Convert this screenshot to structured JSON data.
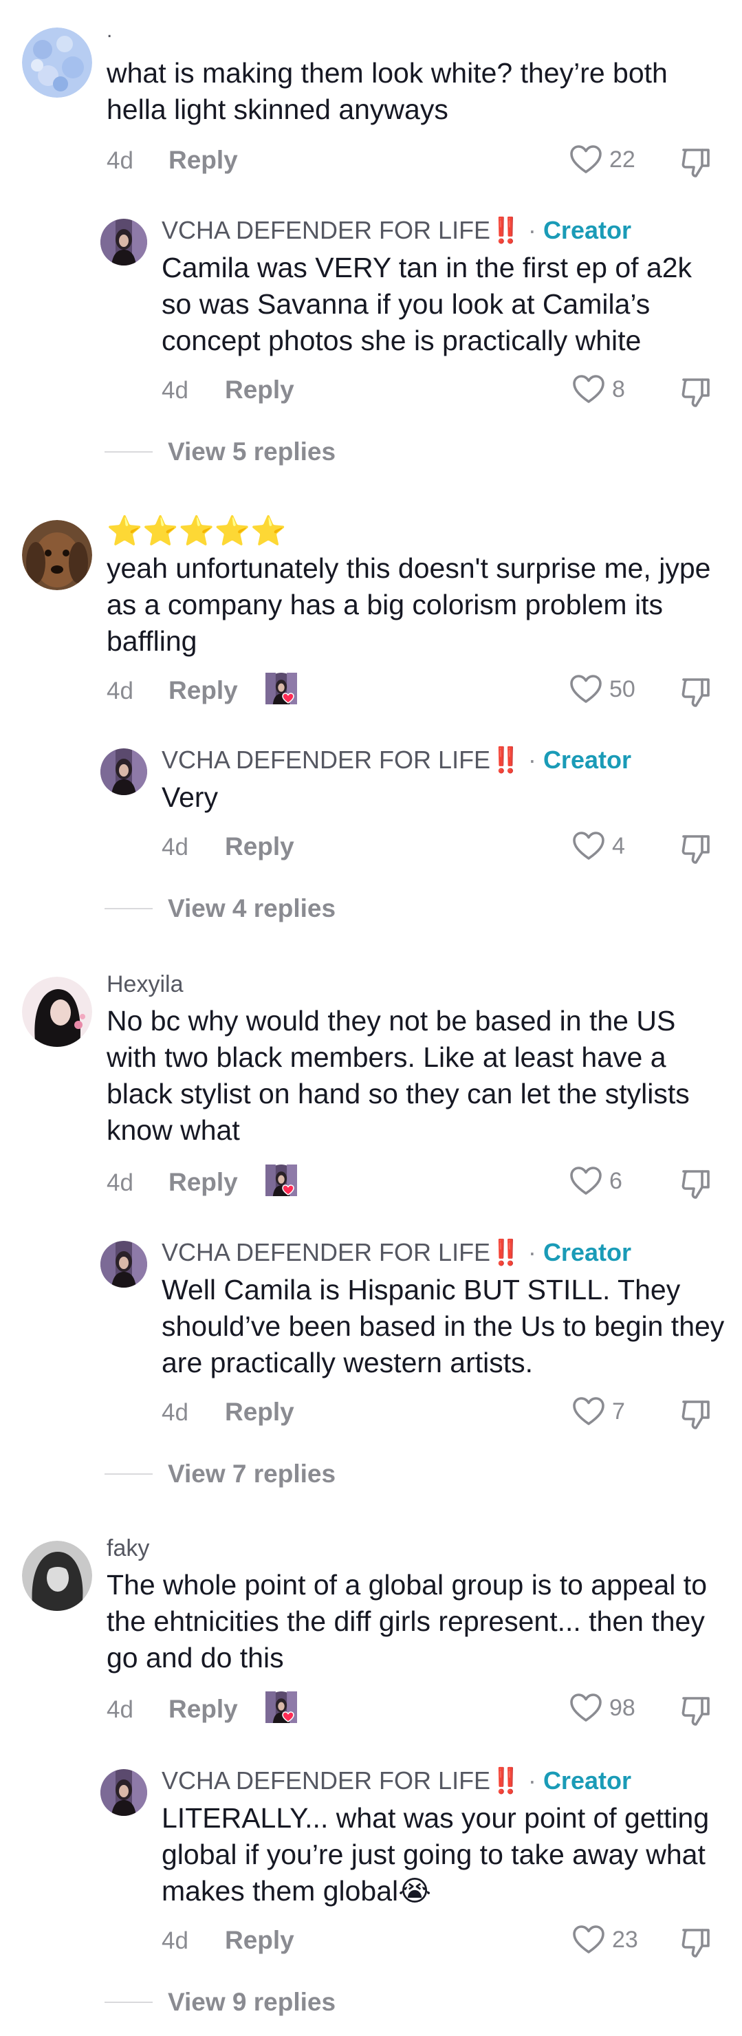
{
  "comments": [
    {
      "username": ".",
      "text": "what is making them look white? they’re both hella light skinned anyways",
      "time": "4d",
      "reply_label": "Reply",
      "likes": "22",
      "reply": {
        "username": "VCHA DEFENDER FOR LIFE",
        "badge": "‼️",
        "separator": "·",
        "creator_label": "Creator",
        "text": "Camila was VERY tan in the first ep of a2k so was Savanna if you look at Camila’s concept photos she is practically white",
        "time": "4d",
        "reply_label": "Reply",
        "likes": "8"
      },
      "view_replies": "View 5 replies"
    },
    {
      "username": "⭐⭐⭐⭐⭐",
      "text": "yeah unfortunately this doesn't surprise me, jype as a company has a big colorism problem its baffling",
      "time": "4d",
      "reply_label": "Reply",
      "likes": "50",
      "reply": {
        "username": "VCHA DEFENDER FOR LIFE",
        "badge": "‼️",
        "separator": "·",
        "creator_label": "Creator",
        "text": "Very",
        "time": "4d",
        "reply_label": "Reply",
        "likes": "4"
      },
      "view_replies": "View 4 replies"
    },
    {
      "username": "Hexyila",
      "text": "No bc why would they not be based in the US with two black members. Like at least have a black stylist on hand so they can let the stylists know what",
      "time": "4d",
      "reply_label": "Reply",
      "likes": "6",
      "reply": {
        "username": "VCHA DEFENDER FOR LIFE",
        "badge": "‼️",
        "separator": "·",
        "creator_label": "Creator",
        "text": "Well Camila is Hispanic BUT STILL. They should’ve been based in the Us to begin they are practically western artists.",
        "time": "4d",
        "reply_label": "Reply",
        "likes": "7"
      },
      "view_replies": "View 7 replies"
    },
    {
      "username": "faky",
      "text": "The whole point of a global group is to appeal to the ehtnicities the diff girls represent... then they go and do this",
      "time": "4d",
      "reply_label": "Reply",
      "likes": "98",
      "reply": {
        "username": "VCHA DEFENDER FOR LIFE",
        "badge": "‼️",
        "separator": "·",
        "creator_label": "Creator",
        "text": "LITERALLY... what was your point of getting global if you’re just going to take away what makes them global😭",
        "time": "4d",
        "reply_label": "Reply",
        "likes": "23"
      },
      "view_replies": "View 9 replies"
    }
  ],
  "icons": {
    "like": "heart-outline-icon",
    "dislike": "thumbs-down-icon",
    "creator_liked": "creator-liked-avatar-icon"
  },
  "colors": {
    "creator": "#1a9bb7",
    "muted": "#8a8b91",
    "badge": "#e53935"
  }
}
